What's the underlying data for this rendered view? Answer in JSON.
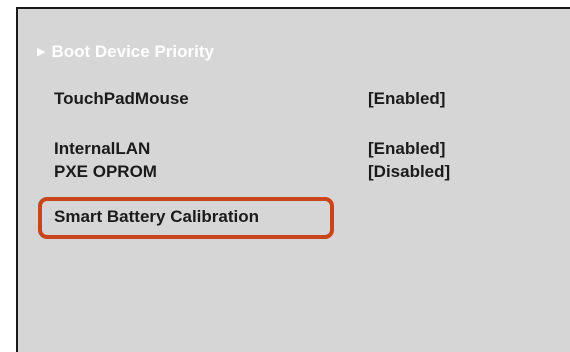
{
  "menu": {
    "submenu_arrow": "▶",
    "submenu_label": "Boot Device Priority",
    "items": [
      {
        "label": "TouchPadMouse",
        "value": "[Enabled]"
      },
      {
        "label": "InternalLAN",
        "value": "[Enabled]"
      },
      {
        "label": "PXE OPROM",
        "value": "[Disabled]"
      },
      {
        "label": "Smart Battery Calibration",
        "value": ""
      }
    ]
  },
  "colors": {
    "background": "#d6d6d6",
    "text": "#1b1b1b",
    "submenu_text": "#ffffff",
    "highlight_border": "#c9461c"
  }
}
